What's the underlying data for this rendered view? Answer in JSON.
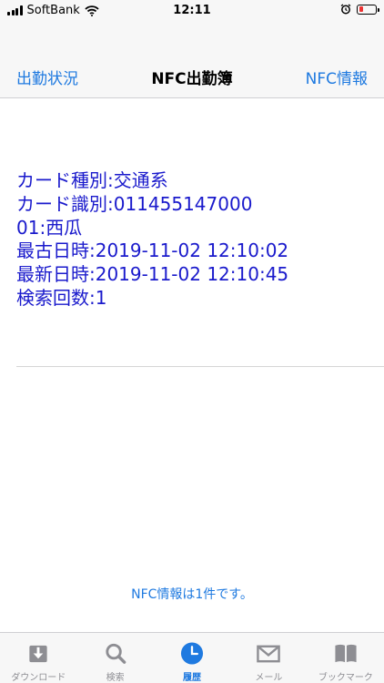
{
  "status_bar": {
    "carrier": "SoftBank",
    "time": "12:11"
  },
  "nav": {
    "left": "出勤状況",
    "title": "NFC出勤簿",
    "right": "NFC情報"
  },
  "detail": [
    "カード種別:交通系",
    "カード識別:011455147000",
    "01:西瓜",
    "最古日時:2019-11-02 12:10:02",
    "最新日時:2019-11-02 12:10:45",
    "検索回数:1"
  ],
  "count_message": "NFC情報は1件です。",
  "tabs": [
    {
      "label": "ダウンロード",
      "icon": "download-icon"
    },
    {
      "label": "検索",
      "icon": "search-icon"
    },
    {
      "label": "履歴",
      "icon": "history-icon",
      "active": true
    },
    {
      "label": "メール",
      "icon": "mail-icon"
    },
    {
      "label": "ブックマーク",
      "icon": "bookmark-icon"
    }
  ],
  "colors": {
    "accent": "#1f7ae0",
    "detail_text": "#1a1acc",
    "inactive_tab": "#8e8e93",
    "battery_low": "#e33333"
  }
}
